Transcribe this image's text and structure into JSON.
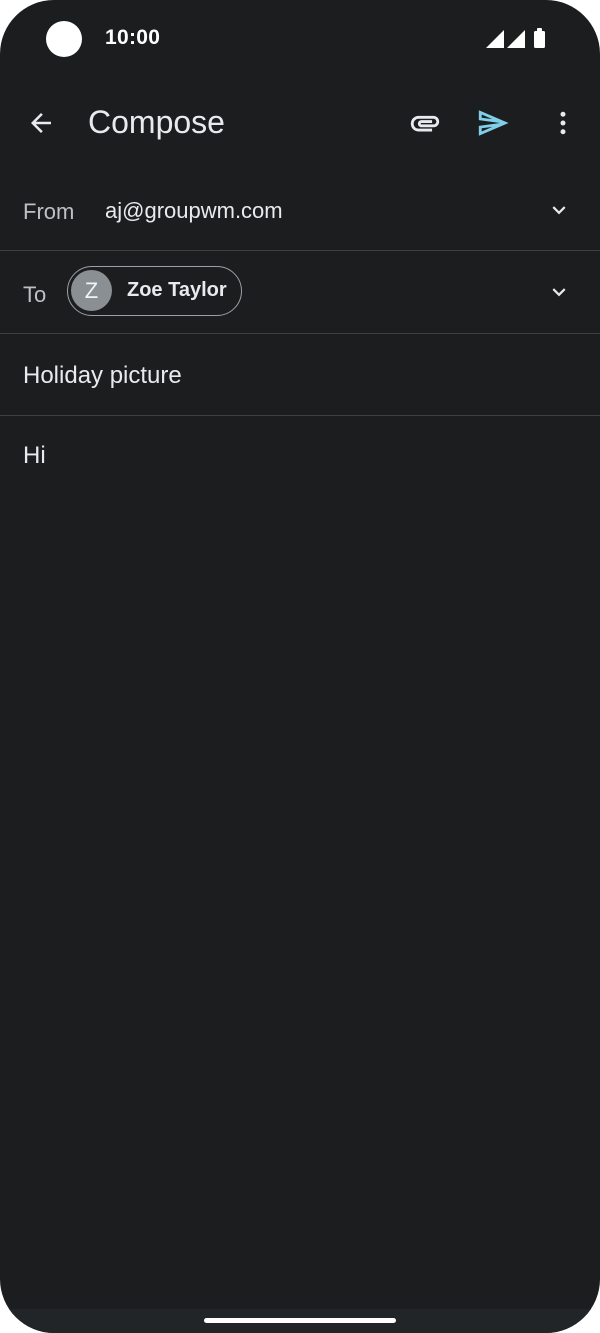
{
  "status_bar": {
    "time": "10:00",
    "icons": [
      "signal-icon",
      "signal-icon",
      "battery-icon"
    ]
  },
  "app_bar": {
    "title": "Compose",
    "icons": {
      "back": "arrow-back-icon",
      "attach": "paperclip-icon",
      "send": "send-icon",
      "more": "more-vert-icon"
    },
    "send_color": "#7fcfe9"
  },
  "from": {
    "label": "From",
    "value": "aj@groupwm.com"
  },
  "to": {
    "label": "To",
    "recipient": {
      "initial": "Z",
      "name": "Zoe Taylor"
    }
  },
  "subject": "Holiday picture",
  "body": "Hi"
}
